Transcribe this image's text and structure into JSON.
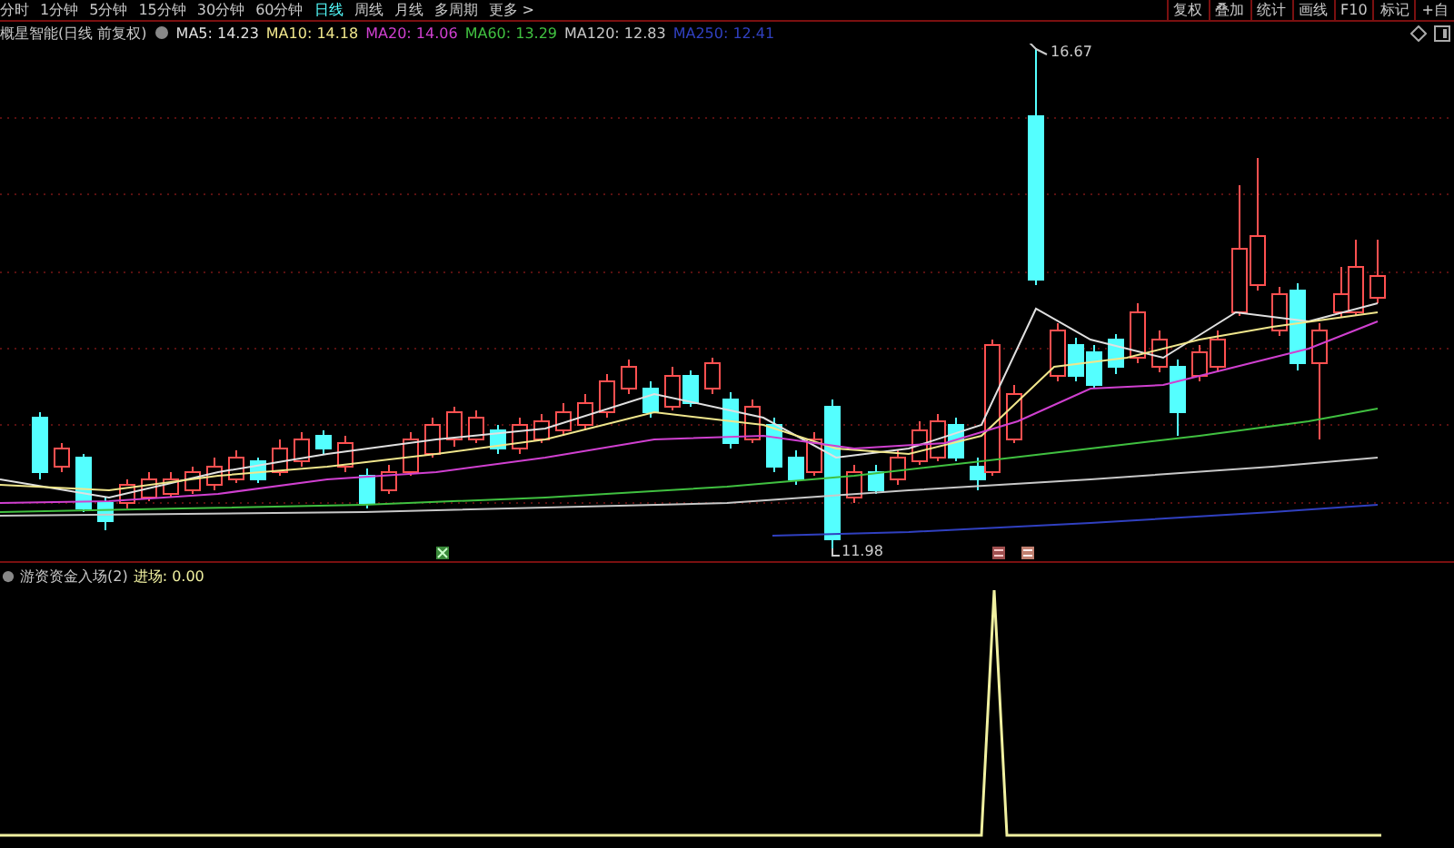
{
  "period_tabs": [
    {
      "label": "分时",
      "selected": false
    },
    {
      "label": "1分钟",
      "selected": false
    },
    {
      "label": "5分钟",
      "selected": false
    },
    {
      "label": "15分钟",
      "selected": false
    },
    {
      "label": "30分钟",
      "selected": false
    },
    {
      "label": "60分钟",
      "selected": false
    },
    {
      "label": "日线",
      "selected": true
    },
    {
      "label": "周线",
      "selected": false
    },
    {
      "label": "月线",
      "selected": false
    },
    {
      "label": "多周期",
      "selected": false
    },
    {
      "label": "更多 >",
      "selected": false
    }
  ],
  "toolbar_buttons": [
    "复权",
    "叠加",
    "统计",
    "画线",
    "F10",
    "标记",
    "+自"
  ],
  "main_chart": {
    "title": "概星智能(日线 前复权)",
    "moving_averages": [
      {
        "label": "MA5: 14.23",
        "color": "#e0e0e0"
      },
      {
        "label": "MA10: 14.18",
        "color": "#f0e68c"
      },
      {
        "label": "MA20: 14.06",
        "color": "#d040d0"
      },
      {
        "label": "MA60: 13.29",
        "color": "#40c040"
      },
      {
        "label": "MA120: 12.83",
        "color": "#c8c8c8"
      },
      {
        "label": "MA250: 12.41",
        "color": "#3040c0"
      }
    ],
    "price_labels": [
      "16.67",
      "11.98"
    ]
  },
  "indicator": {
    "title": "游资资金入场(2)",
    "reading": "进场: 0.00"
  }
}
